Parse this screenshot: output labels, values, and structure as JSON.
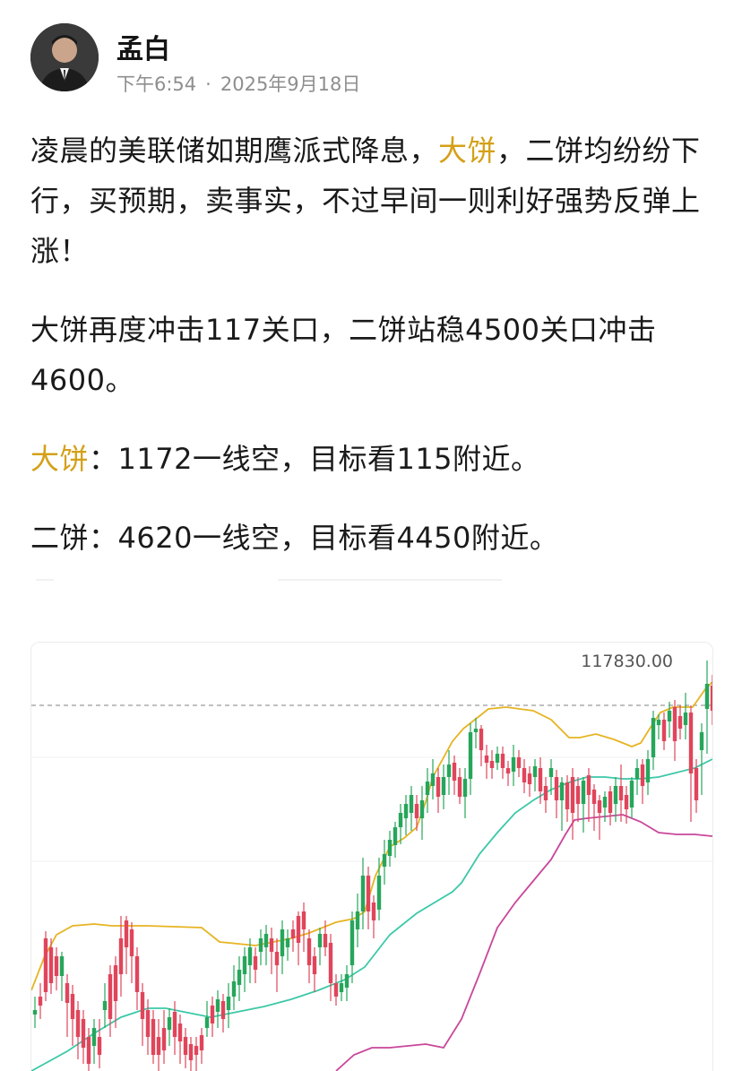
{
  "author": {
    "name": "孟白",
    "time": "下午6:54",
    "separator": "·",
    "date": "2025年9月18日"
  },
  "post": {
    "p1_a": "凌晨的美联储如期鹰派式降息，",
    "p1_hl": "大饼",
    "p1_b": "，二饼均纷纷下行，买预期，卖事实，不过早间一则利好强势反弹上涨！",
    "p2": "大饼再度冲击117关口，二饼站稳4500关口冲击4600。",
    "p3_hl": "大饼",
    "p3_b": "：1172一线空，目标看115附近。",
    "p4": "二饼：4620一线空，目标看4450附近。"
  },
  "chart_data": {
    "type": "candlestick",
    "price_label": "117830.00",
    "colors": {
      "up": "#26a65b",
      "down": "#e0455b",
      "upper_band": "#e6b422",
      "lower_band": "#c9469a",
      "middle": "#3cc8a8",
      "dashed_line": "#9a9a9a"
    }
  }
}
